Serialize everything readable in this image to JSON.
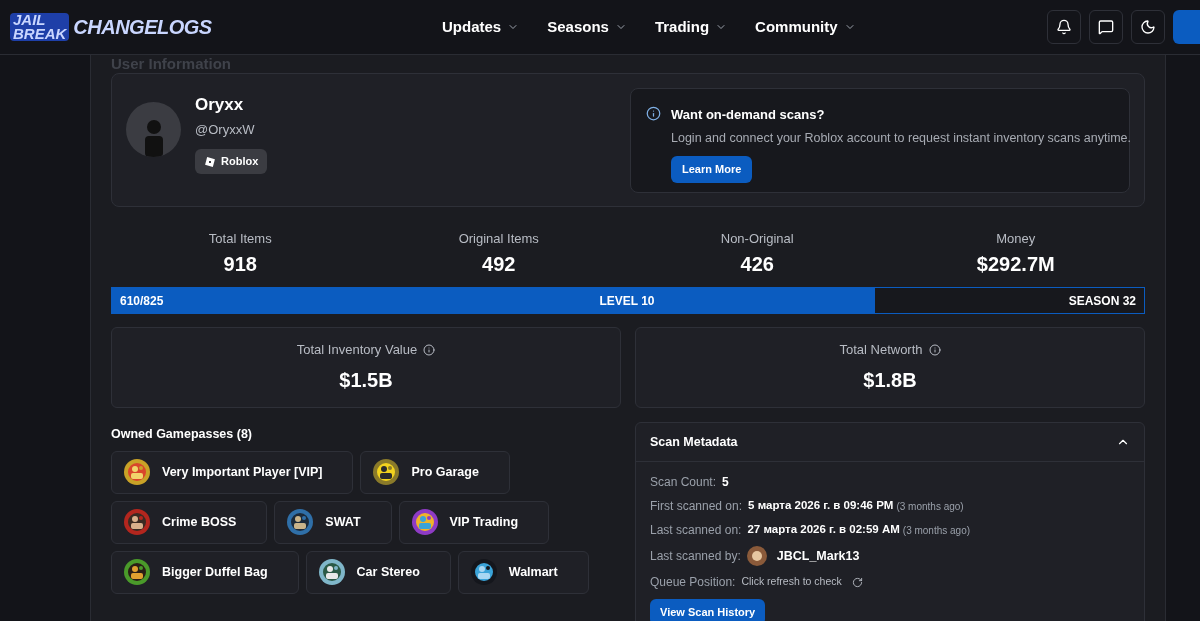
{
  "header": {
    "logo_top": "JAIL",
    "logo_bottom": "BREAK",
    "logo_title": "CHANGELOGS",
    "nav": [
      {
        "label": "Updates"
      },
      {
        "label": "Seasons"
      },
      {
        "label": "Trading"
      },
      {
        "label": "Community"
      }
    ]
  },
  "section_title": "User Information",
  "profile": {
    "display_name": "Oryxx",
    "username": "@OryxxW",
    "platform_badge": "Roblox"
  },
  "promo": {
    "title": "Want on-demand scans?",
    "text": "Login and connect your Roblox account to request instant inventory scans anytime.",
    "button": "Learn More"
  },
  "stats": [
    {
      "label": "Total Items",
      "value": "918"
    },
    {
      "label": "Original Items",
      "value": "492"
    },
    {
      "label": "Non-Original",
      "value": "426"
    },
    {
      "label": "Money",
      "value": "$292.7M"
    }
  ],
  "level_bar": {
    "progress": "610/825",
    "level_label": "LEVEL 10",
    "season_label": "SEASON 32",
    "level": 0.739
  },
  "value_cards": [
    {
      "label": "Total Inventory Value",
      "value": "$1.5B"
    },
    {
      "label": "Total Networth",
      "value": "$1.8B"
    }
  ],
  "gamepasses": {
    "title": "Owned Gamepasses (8)",
    "rows": [
      [
        {
          "name": "Very Important Player [VIP]"
        },
        {
          "name": "Pro Garage"
        }
      ],
      [
        {
          "name": "Crime BOSS"
        },
        {
          "name": "SWAT"
        },
        {
          "name": "VIP Trading"
        }
      ],
      [
        {
          "name": "Bigger Duffel Bag"
        },
        {
          "name": "Car Stereo"
        },
        {
          "name": "Walmart"
        }
      ]
    ]
  },
  "scan_metadata": {
    "title": "Scan Metadata",
    "expanded": true,
    "scan_count_label": "Scan Count:",
    "scan_count": "5",
    "first_label": "First scanned on:",
    "first_value": "5 марта 2026 г. в 09:46 PM",
    "first_ago": "(3 months ago)",
    "last_label": "Last scanned on:",
    "last_value": "27 марта 2026 г. в 02:59 AM",
    "last_ago": "(3 months ago)",
    "by_label": "Last scanned by:",
    "by_value": "JBCL_Mark13",
    "queue_label": "Queue Position:",
    "queue_value": "Click refresh to check",
    "button": "View Scan History"
  }
}
